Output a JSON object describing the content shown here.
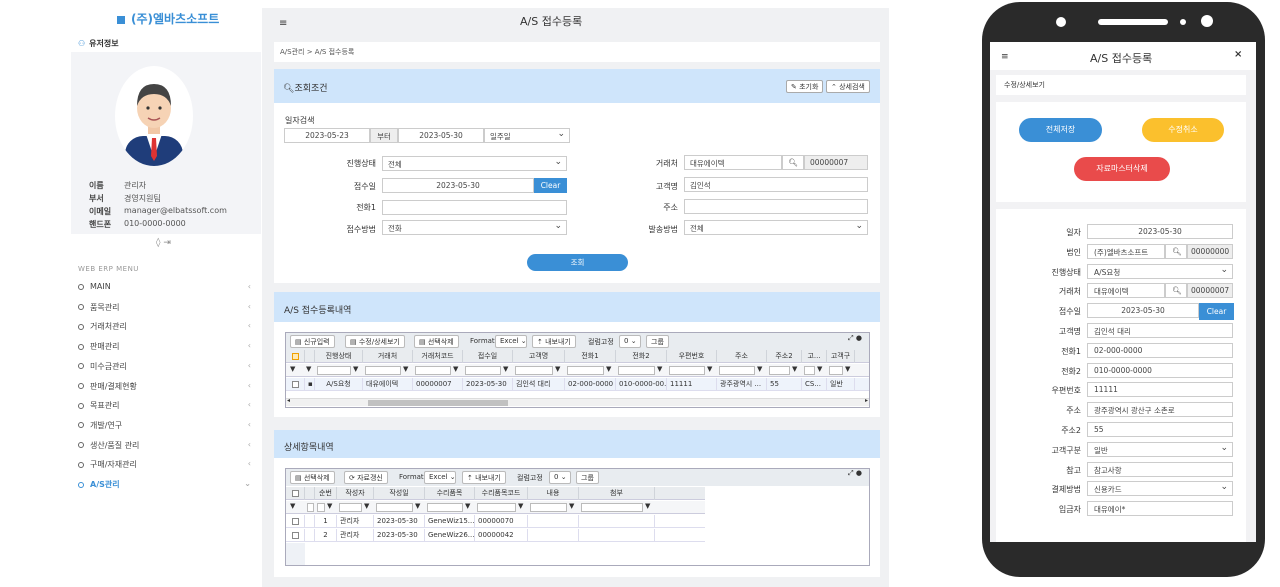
{
  "brand": "(주)엘바츠소프트",
  "user": {
    "header": "유저정보",
    "fields": [
      {
        "k": "이름",
        "v": "관리자"
      },
      {
        "k": "부서",
        "v": "경영지원팀"
      },
      {
        "k": "이메일",
        "v": "manager@elbatssoft.com"
      },
      {
        "k": "핸드폰",
        "v": "010-0000-0000"
      }
    ]
  },
  "menu": {
    "title": "WEB ERP MENU",
    "items": [
      "MAIN",
      "품목관리",
      "거래처관리",
      "판매관리",
      "미수금관리",
      "판매/결제현황",
      "목표관리",
      "개발/연구",
      "생산/품질 관리",
      "구매/자재관리",
      "A/S관리"
    ]
  },
  "page": {
    "title": "A/S 접수등록",
    "breadcrumb": "A/S관리 > A/S 접수등록"
  },
  "search": {
    "title": "조회조건",
    "reset": "초기화",
    "detail": "상세검색",
    "date_label": "일자검색",
    "date_from": "2023-05-23",
    "date_sep": "부터",
    "date_to": "2023-05-30",
    "period": "일주일",
    "status_label": "진행상태",
    "status": "전체",
    "recv_label": "접수일",
    "recv": "2023-05-30",
    "clear": "Clear",
    "phone1_label": "전화1",
    "method_label": "접수방법",
    "method": "전화",
    "client_label": "거래처",
    "client": "대유에이텍",
    "client_code": "00000007",
    "cust_label": "고객명",
    "cust": "김인석",
    "addr_label": "주소",
    "ship_label": "발송방법",
    "ship": "전체",
    "submit": "조회"
  },
  "grid1": {
    "title": "A/S 접수등록내역",
    "buttons": [
      "신규입력",
      "수정/상세보기",
      "선택삭제"
    ],
    "format_label": "Format",
    "format": "Excel",
    "export": "내보내기",
    "fix_label": "컬럼고정",
    "fix": "0",
    "group": "그룹",
    "headers": [
      "진행상태",
      "거래처",
      "거래처코드",
      "접수일",
      "고객명",
      "전화1",
      "전화2",
      "우편번호",
      "주소",
      "주소2",
      "고...",
      "고객구"
    ],
    "row": [
      "A/S요청",
      "대유에이텍",
      "00000007",
      "2023-05-30",
      "김인석 대리",
      "02-000-0000",
      "010-0000-00...",
      "11111",
      "광주광역시 ...",
      "55",
      "CS...",
      "일반"
    ]
  },
  "grid2": {
    "title": "상세항목내역",
    "buttons": [
      "선택삭제",
      "자료갱신"
    ],
    "format_label": "Format",
    "format": "Excel",
    "export": "내보내기",
    "fix_label": "컬럼고정",
    "fix": "0",
    "group": "그룹",
    "headers": [
      "순번",
      "작성자",
      "작성일",
      "수리품목",
      "수리품목코드",
      "내용",
      "첨부"
    ],
    "rows": [
      [
        "1",
        "관리자",
        "2023-05-30",
        "GeneWiz15...",
        "00000070",
        "",
        ""
      ],
      [
        "2",
        "관리자",
        "2023-05-30",
        "GeneWiz26...",
        "00000042",
        "",
        ""
      ]
    ]
  },
  "mobile": {
    "title": "A/S 접수등록",
    "close": "×",
    "sub": "수정/상세보기",
    "save": "전체저장",
    "cancel": "수정취소",
    "delete": "자료마스터삭제",
    "fields": [
      {
        "k": "일자",
        "v": "2023-05-30"
      },
      {
        "k": "법인",
        "v": "(주)엘바츠소프트",
        "code": "00000000"
      },
      {
        "k": "진행상태",
        "v": "A/S요청"
      },
      {
        "k": "거래처",
        "v": "대유에이텍",
        "code": "00000007"
      },
      {
        "k": "접수일",
        "v": "2023-05-30",
        "clear": "Clear"
      },
      {
        "k": "고객명",
        "v": "김인석 대리"
      },
      {
        "k": "전화1",
        "v": "02-000-0000"
      },
      {
        "k": "전화2",
        "v": "010-0000-0000"
      },
      {
        "k": "우편번호",
        "v": "11111"
      },
      {
        "k": "주소",
        "v": "광주광역시 광산구 소촌로"
      },
      {
        "k": "주소2",
        "v": "55"
      },
      {
        "k": "고객구분",
        "v": "일반"
      },
      {
        "k": "참고",
        "v": "참고사항"
      },
      {
        "k": "결제방법",
        "v": "신용카드"
      },
      {
        "k": "입금자",
        "v": "대유에이*"
      }
    ]
  }
}
